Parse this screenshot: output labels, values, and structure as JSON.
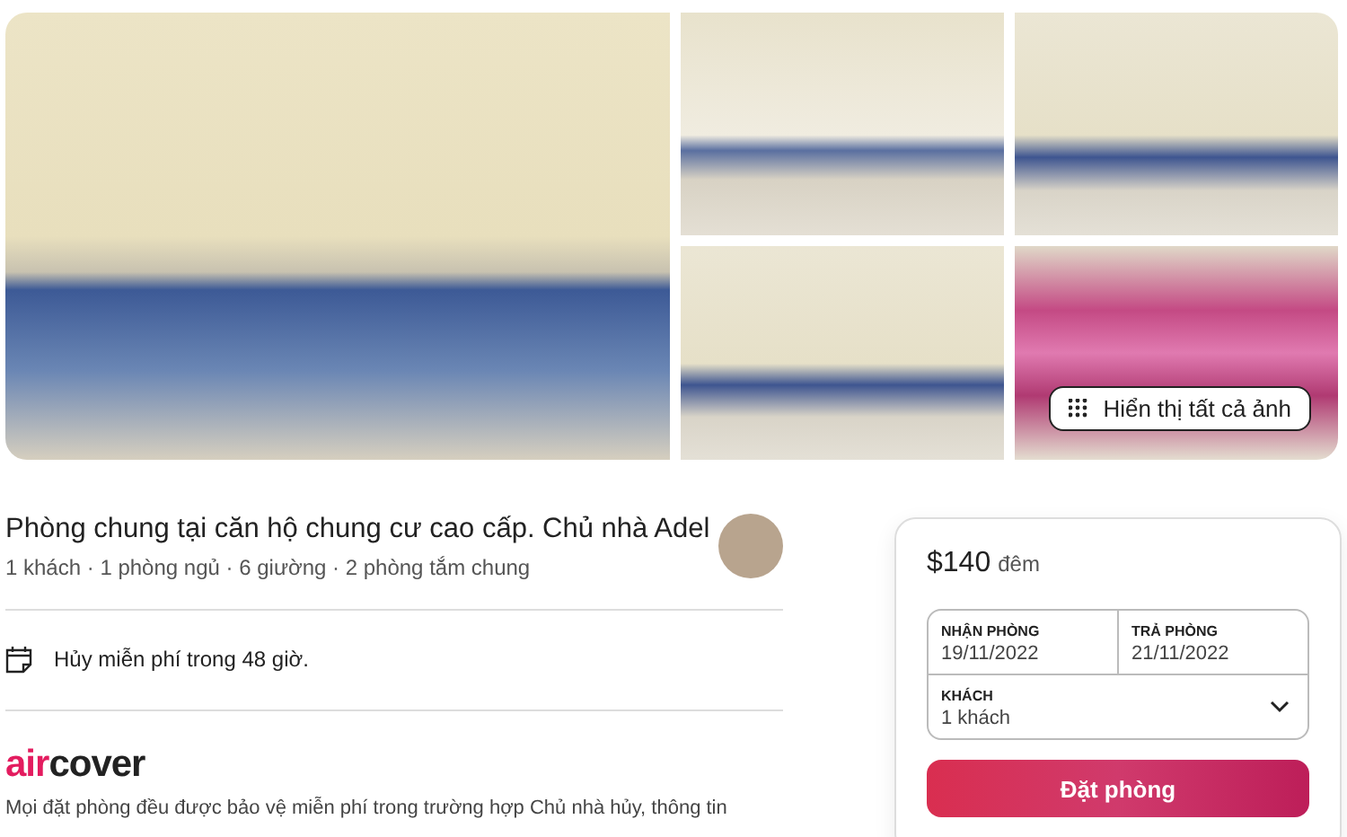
{
  "photos": [
    {
      "kind": "living-room"
    },
    {
      "kind": "hallway"
    },
    {
      "kind": "room"
    },
    {
      "kind": "room"
    },
    {
      "kind": "bunk-beds"
    }
  ],
  "show_all_button": {
    "label": "Hiển thị tất cả ảnh"
  },
  "listing": {
    "title": "Phòng chung tại căn hộ chung cư cao cấp. Chủ nhà Adel",
    "details": "1 khách · 1 phòng ngủ  · 6 giường · 2 phòng tắm chung"
  },
  "cancellation": {
    "text": "Hủy miễn phí trong 48 giờ."
  },
  "aircover": {
    "accent": "air",
    "rest": "cover",
    "description": "Mọi đặt phòng đều được bảo vệ miễn phí trong trường hợp Chủ nhà hủy, thông tin"
  },
  "booking": {
    "price": "$140",
    "unit": "đêm",
    "checkin_label": "NHẬN PHÒNG",
    "checkin": "19/11/2022",
    "checkout_label": "TRẢ PHÒNG",
    "checkout": "21/11/2022",
    "guests_label": "KHÁCH",
    "guests": "1 khách",
    "button": "Đặt phòng"
  }
}
